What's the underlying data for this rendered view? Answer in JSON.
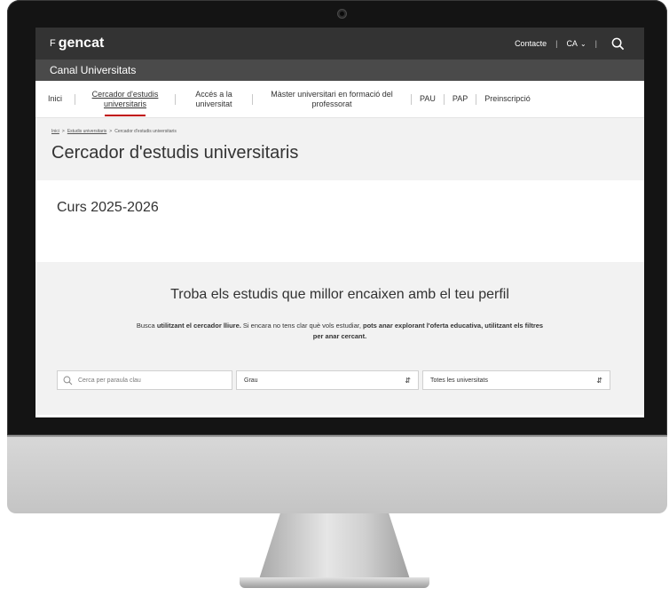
{
  "site": {
    "logo": "gencat",
    "logo_mark": "F",
    "contact": "Contacte",
    "language": "CA",
    "sub_title": "Canal Universitats"
  },
  "nav": {
    "items": [
      {
        "label": "Inici"
      },
      {
        "label": "Cercador d'estudis universitaris",
        "active": true
      },
      {
        "label": "Accés a la universitat"
      },
      {
        "label": "Màster universitari en formació del professorat"
      },
      {
        "label": "PAU"
      },
      {
        "label": "PAP"
      },
      {
        "label": "Preinscripció"
      }
    ]
  },
  "breadcrumb": {
    "home": "Inici",
    "studies": "Estudis universitaris",
    "current": "Cercador d'estudis universitaris"
  },
  "page": {
    "title": "Cercador d'estudis universitaris",
    "course": "Curs 2025-2026"
  },
  "search": {
    "headline": "Troba els estudis que millor encaixen amb el teu perfil",
    "intro_1": "Busca ",
    "intro_2": "utilitzant el cercador lliure.",
    "intro_3": " Si encara no tens clar què vols estudiar, ",
    "intro_4": "pots anar explorant l'oferta educativa, utilitzant els filtres per anar cercant.",
    "placeholder": "Cerca per paraula clau",
    "degree_selected": "Grau",
    "university_selected": "Totes les universitats"
  },
  "colors": {
    "topbar": "#333333",
    "subbar": "#4a4a4a",
    "accent": "#c00000",
    "band": "#f2f2f2"
  }
}
